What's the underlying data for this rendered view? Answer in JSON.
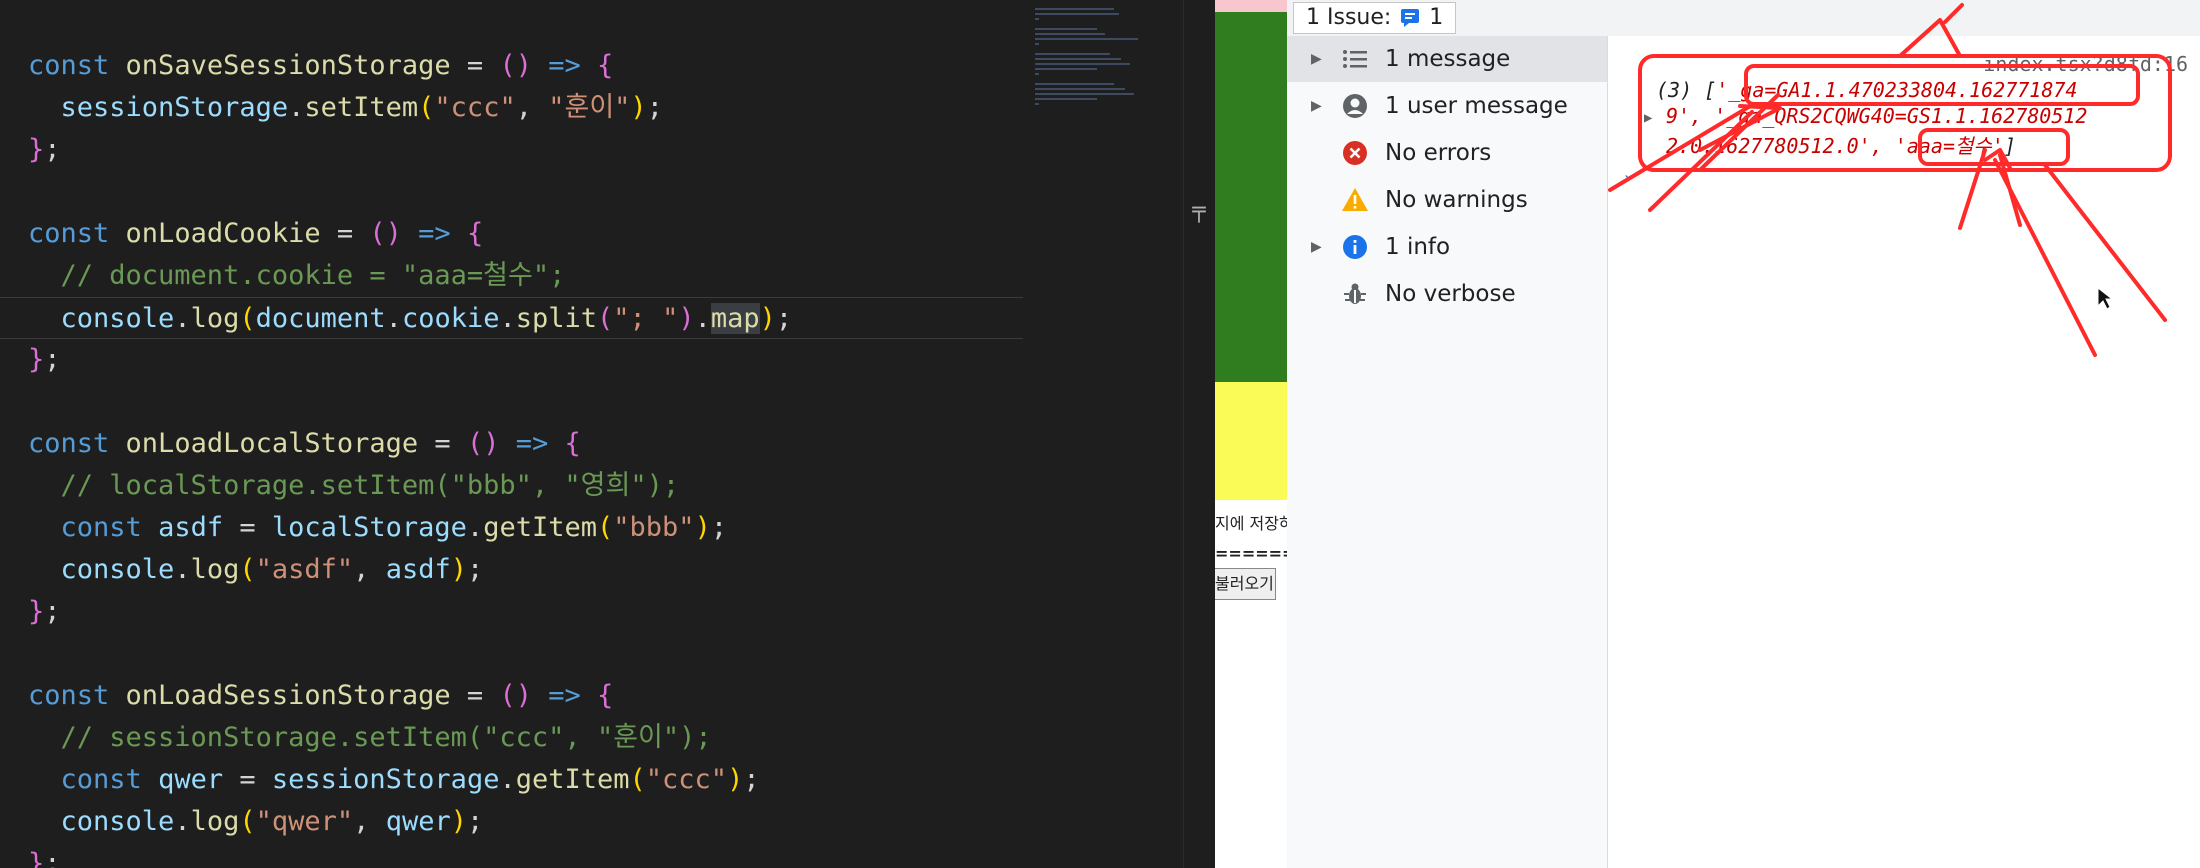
{
  "code": [
    {
      "n": 1,
      "tokens": [
        {
          "c": "kw",
          "t": "const "
        },
        {
          "c": "fn",
          "t": "onSaveSessionStorage"
        },
        {
          "c": "pw",
          "t": " = "
        },
        {
          "c": "pn",
          "t": "()"
        },
        {
          "c": "ar",
          "t": " => "
        },
        {
          "c": "pn",
          "t": "{"
        }
      ]
    },
    {
      "n": 2,
      "tokens": [
        {
          "c": "pw",
          "t": "  "
        },
        {
          "c": "vr",
          "t": "sessionStorage"
        },
        {
          "c": "pw",
          "t": "."
        },
        {
          "c": "fn",
          "t": "setItem"
        },
        {
          "c": "py",
          "t": "("
        },
        {
          "c": "st",
          "t": "\"ccc\""
        },
        {
          "c": "pw",
          "t": ", "
        },
        {
          "c": "st",
          "t": "\"훈이\""
        },
        {
          "c": "py",
          "t": ")"
        },
        {
          "c": "pw",
          "t": ";"
        }
      ]
    },
    {
      "n": 3,
      "tokens": [
        {
          "c": "pn",
          "t": "}"
        },
        {
          "c": "pw",
          "t": ";"
        }
      ]
    },
    {
      "n": 4,
      "tokens": []
    },
    {
      "n": 5,
      "tokens": [
        {
          "c": "kw",
          "t": "const "
        },
        {
          "c": "fn",
          "t": "onLoadCookie"
        },
        {
          "c": "pw",
          "t": " = "
        },
        {
          "c": "pn",
          "t": "()"
        },
        {
          "c": "ar",
          "t": " => "
        },
        {
          "c": "pn",
          "t": "{"
        }
      ]
    },
    {
      "n": 6,
      "tokens": [
        {
          "c": "cm",
          "t": "  // document.cookie = \"aaa=철수\";"
        }
      ]
    },
    {
      "n": 7,
      "cur": true,
      "tokens": [
        {
          "c": "pw",
          "t": "  "
        },
        {
          "c": "vr",
          "t": "console"
        },
        {
          "c": "pw",
          "t": "."
        },
        {
          "c": "fn",
          "t": "log"
        },
        {
          "c": "py",
          "t": "("
        },
        {
          "c": "vr",
          "t": "document"
        },
        {
          "c": "pw",
          "t": "."
        },
        {
          "c": "vr",
          "t": "cookie"
        },
        {
          "c": "pw",
          "t": "."
        },
        {
          "c": "fn",
          "t": "split"
        },
        {
          "c": "pn",
          "t": "("
        },
        {
          "c": "st",
          "t": "\"; \""
        },
        {
          "c": "pn",
          "t": ")"
        },
        {
          "c": "pw",
          "t": "."
        },
        {
          "c": "fn mapsel",
          "t": "map"
        },
        {
          "c": "py",
          "t": ")"
        },
        {
          "c": "pw",
          "t": ";"
        }
      ]
    },
    {
      "n": 8,
      "tokens": [
        {
          "c": "pn",
          "t": "}"
        },
        {
          "c": "pw",
          "t": ";"
        }
      ]
    },
    {
      "n": 9,
      "tokens": []
    },
    {
      "n": 10,
      "tokens": [
        {
          "c": "kw",
          "t": "const "
        },
        {
          "c": "fn",
          "t": "onLoadLocalStorage"
        },
        {
          "c": "pw",
          "t": " = "
        },
        {
          "c": "pn",
          "t": "()"
        },
        {
          "c": "ar",
          "t": " => "
        },
        {
          "c": "pn",
          "t": "{"
        }
      ]
    },
    {
      "n": 11,
      "tokens": [
        {
          "c": "cm",
          "t": "  // localStorage.setItem(\"bbb\", \"영희\");"
        }
      ]
    },
    {
      "n": 12,
      "tokens": [
        {
          "c": "pw",
          "t": "  "
        },
        {
          "c": "kw",
          "t": "const "
        },
        {
          "c": "vr",
          "t": "asdf"
        },
        {
          "c": "pw",
          "t": " = "
        },
        {
          "c": "vr",
          "t": "localStorage"
        },
        {
          "c": "pw",
          "t": "."
        },
        {
          "c": "fn",
          "t": "getItem"
        },
        {
          "c": "py",
          "t": "("
        },
        {
          "c": "st",
          "t": "\"bbb\""
        },
        {
          "c": "py",
          "t": ")"
        },
        {
          "c": "pw",
          "t": ";"
        }
      ]
    },
    {
      "n": 13,
      "tokens": [
        {
          "c": "pw",
          "t": "  "
        },
        {
          "c": "vr",
          "t": "console"
        },
        {
          "c": "pw",
          "t": "."
        },
        {
          "c": "fn",
          "t": "log"
        },
        {
          "c": "py",
          "t": "("
        },
        {
          "c": "st",
          "t": "\"asdf\""
        },
        {
          "c": "pw",
          "t": ", "
        },
        {
          "c": "vr",
          "t": "asdf"
        },
        {
          "c": "py",
          "t": ")"
        },
        {
          "c": "pw",
          "t": ";"
        }
      ]
    },
    {
      "n": 14,
      "tokens": [
        {
          "c": "pn",
          "t": "}"
        },
        {
          "c": "pw",
          "t": ";"
        }
      ]
    },
    {
      "n": 15,
      "tokens": []
    },
    {
      "n": 16,
      "tokens": [
        {
          "c": "kw",
          "t": "const "
        },
        {
          "c": "fn",
          "t": "onLoadSessionStorage"
        },
        {
          "c": "pw",
          "t": " = "
        },
        {
          "c": "pn",
          "t": "()"
        },
        {
          "c": "ar",
          "t": " => "
        },
        {
          "c": "pn",
          "t": "{"
        }
      ]
    },
    {
      "n": 17,
      "tokens": [
        {
          "c": "cm",
          "t": "  // sessionStorage.setItem(\"ccc\", \"훈이\");"
        }
      ]
    },
    {
      "n": 18,
      "tokens": [
        {
          "c": "pw",
          "t": "  "
        },
        {
          "c": "kw",
          "t": "const "
        },
        {
          "c": "vr",
          "t": "qwer"
        },
        {
          "c": "pw",
          "t": " = "
        },
        {
          "c": "vr",
          "t": "sessionStorage"
        },
        {
          "c": "pw",
          "t": "."
        },
        {
          "c": "fn",
          "t": "getItem"
        },
        {
          "c": "py",
          "t": "("
        },
        {
          "c": "st",
          "t": "\"ccc\""
        },
        {
          "c": "py",
          "t": ")"
        },
        {
          "c": "pw",
          "t": ";"
        }
      ]
    },
    {
      "n": 19,
      "tokens": [
        {
          "c": "pw",
          "t": "  "
        },
        {
          "c": "vr",
          "t": "console"
        },
        {
          "c": "pw",
          "t": "."
        },
        {
          "c": "fn",
          "t": "log"
        },
        {
          "c": "py",
          "t": "("
        },
        {
          "c": "st",
          "t": "\"qwer\""
        },
        {
          "c": "pw",
          "t": ", "
        },
        {
          "c": "vr",
          "t": "qwer"
        },
        {
          "c": "py",
          "t": ")"
        },
        {
          "c": "pw",
          "t": ";"
        }
      ]
    },
    {
      "n": 20,
      "tokens": [
        {
          "c": "pn",
          "t": "}"
        },
        {
          "c": "pw",
          "t": ";"
        }
      ]
    }
  ],
  "browser": {
    "text1": "지에 저장하",
    "text2": "========",
    "button": "불러오기"
  },
  "devtools": {
    "issue_label": "1 Issue:",
    "issue_count": "1",
    "sidebar": [
      {
        "label": "1 message",
        "icon": "list-icon",
        "expand": true,
        "selected": true
      },
      {
        "label": "1 user message",
        "icon": "user-icon",
        "expand": true,
        "selected": false
      },
      {
        "label": "No errors",
        "icon": "error-icon",
        "expand": false,
        "selected": false
      },
      {
        "label": "No warnings",
        "icon": "warning-icon",
        "expand": false,
        "selected": false
      },
      {
        "label": "1 info",
        "icon": "info-icon",
        "expand": true,
        "selected": false
      },
      {
        "label": "No verbose",
        "icon": "bug-icon",
        "expand": false,
        "selected": false
      }
    ],
    "console": {
      "source": "index.tsx?d8fd:16",
      "line1_prefix": "(3) [",
      "line1_value": "'_ga=GA1.1.470233804.162771874",
      "line2_value": "9', '_ga_QRS2CQWG40=GS1.1.162780512",
      "line3_value": "2.0.1627780512.0', 'aaa=철수'",
      "line3_suffix": "]"
    }
  },
  "colors": {
    "editor_bg": "#1e1e1e",
    "annotation": "#ff2a2a"
  }
}
